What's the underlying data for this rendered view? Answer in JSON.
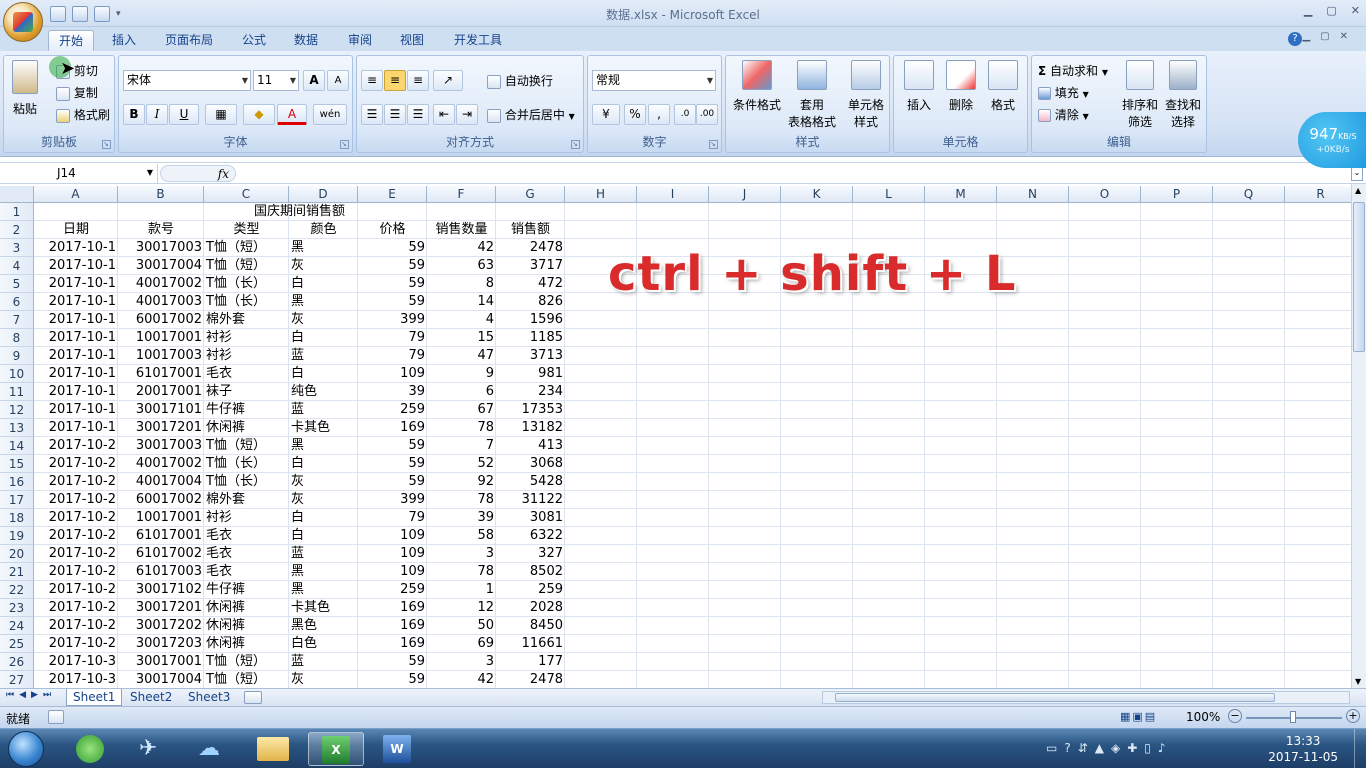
{
  "window": {
    "title": "数据.xlsx - Microsoft Excel"
  },
  "ribbon_tabs": [
    "开始",
    "插入",
    "页面布局",
    "公式",
    "数据",
    "审阅",
    "视图",
    "开发工具"
  ],
  "ribbon": {
    "clipboard": {
      "paste": "粘贴",
      "cut": "剪切",
      "copy": "复制",
      "format_painter": "格式刷",
      "label": "剪贴板"
    },
    "font": {
      "name": "宋体",
      "size": "11",
      "bold": "B",
      "italic": "I",
      "underline": "U",
      "label": "字体",
      "grow": "A",
      "shrink": "A",
      "color_a": "A",
      "wen": "wén"
    },
    "alignment": {
      "wrap": "自动换行",
      "merge": "合并后居中",
      "label": "对齐方式"
    },
    "number": {
      "format": "常规",
      "percent": "%",
      "comma": ",",
      "label": "数字"
    },
    "styles": {
      "conditional": "条件格式",
      "table1": "套用",
      "table2": "表格格式",
      "cell1": "单元格",
      "cell2": "样式",
      "label": "样式"
    },
    "cells": {
      "insert": "插入",
      "delete": "删除",
      "format": "格式",
      "label": "单元格"
    },
    "editing": {
      "autosum": "自动求和",
      "fill": "填充",
      "clear": "清除",
      "sort1": "排序和",
      "sort2": "筛选",
      "find1": "查找和",
      "find2": "选择",
      "label": "编辑"
    }
  },
  "net_speed": {
    "down": "947",
    "unit": "KB/S",
    "up": "+0KB/s"
  },
  "formula_bar": {
    "name_box": "J14",
    "fx": "fx"
  },
  "columns": [
    "A",
    "B",
    "C",
    "D",
    "E",
    "F",
    "G",
    "H",
    "I",
    "J",
    "K",
    "L",
    "M",
    "N",
    "O",
    "P",
    "Q",
    "R"
  ],
  "sheet": {
    "title": "国庆期间销售额",
    "headers": [
      "日期",
      "款号",
      "类型",
      "颜色",
      "价格",
      "销售数量",
      "销售额"
    ],
    "rows": [
      [
        "2017-10-1",
        "30017003",
        "T恤（短）",
        "黑",
        "59",
        "42",
        "2478"
      ],
      [
        "2017-10-1",
        "30017004",
        "T恤（短）",
        "灰",
        "59",
        "63",
        "3717"
      ],
      [
        "2017-10-1",
        "40017002",
        "T恤（长）",
        "白",
        "59",
        "8",
        "472"
      ],
      [
        "2017-10-1",
        "40017003",
        "T恤（长）",
        "黑",
        "59",
        "14",
        "826"
      ],
      [
        "2017-10-1",
        "60017002",
        "棉外套",
        "灰",
        "399",
        "4",
        "1596"
      ],
      [
        "2017-10-1",
        "10017001",
        "衬衫",
        "白",
        "79",
        "15",
        "1185"
      ],
      [
        "2017-10-1",
        "10017003",
        "衬衫",
        "蓝",
        "79",
        "47",
        "3713"
      ],
      [
        "2017-10-1",
        "61017001",
        "毛衣",
        "白",
        "109",
        "9",
        "981"
      ],
      [
        "2017-10-1",
        "20017001",
        "袜子",
        "纯色",
        "39",
        "6",
        "234"
      ],
      [
        "2017-10-1",
        "30017101",
        "牛仔裤",
        "蓝",
        "259",
        "67",
        "17353"
      ],
      [
        "2017-10-1",
        "30017201",
        "休闲裤",
        "卡其色",
        "169",
        "78",
        "13182"
      ],
      [
        "2017-10-2",
        "30017003",
        "T恤（短）",
        "黑",
        "59",
        "7",
        "413"
      ],
      [
        "2017-10-2",
        "40017002",
        "T恤（长）",
        "白",
        "59",
        "52",
        "3068"
      ],
      [
        "2017-10-2",
        "40017004",
        "T恤（长）",
        "灰",
        "59",
        "92",
        "5428"
      ],
      [
        "2017-10-2",
        "60017002",
        "棉外套",
        "灰",
        "399",
        "78",
        "31122"
      ],
      [
        "2017-10-2",
        "10017001",
        "衬衫",
        "白",
        "79",
        "39",
        "3081"
      ],
      [
        "2017-10-2",
        "61017001",
        "毛衣",
        "白",
        "109",
        "58",
        "6322"
      ],
      [
        "2017-10-2",
        "61017002",
        "毛衣",
        "蓝",
        "109",
        "3",
        "327"
      ],
      [
        "2017-10-2",
        "61017003",
        "毛衣",
        "黑",
        "109",
        "78",
        "8502"
      ],
      [
        "2017-10-2",
        "30017102",
        "牛仔裤",
        "黑",
        "259",
        "1",
        "259"
      ],
      [
        "2017-10-2",
        "30017201",
        "休闲裤",
        "卡其色",
        "169",
        "12",
        "2028"
      ],
      [
        "2017-10-2",
        "30017202",
        "休闲裤",
        "黑色",
        "169",
        "50",
        "8450"
      ],
      [
        "2017-10-2",
        "30017203",
        "休闲裤",
        "白色",
        "169",
        "69",
        "11661"
      ],
      [
        "2017-10-3",
        "30017001",
        "T恤（短）",
        "蓝",
        "59",
        "3",
        "177"
      ],
      [
        "2017-10-3",
        "30017004",
        "T恤（短）",
        "灰",
        "59",
        "42",
        "2478"
      ]
    ]
  },
  "annotation": "ctrl + shift + L",
  "sheet_tabs": [
    "Sheet1",
    "Sheet2",
    "Sheet3"
  ],
  "status": {
    "ready": "就绪",
    "zoom": "100%"
  },
  "clock": {
    "time": "13:33",
    "date": "2017-11-05"
  },
  "colors": {
    "annotation": "#d92b2b",
    "ribbon_text": "#15428b"
  }
}
